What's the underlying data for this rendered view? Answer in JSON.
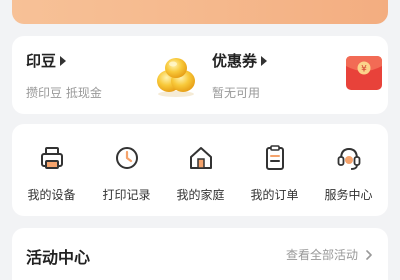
{
  "banner": {
    "items": [
      "",
      "",
      "",
      ""
    ]
  },
  "assets": {
    "yindou": {
      "title": "印豆",
      "subtitle": "攒印豆 抵现金"
    },
    "coupon": {
      "title": "优惠券",
      "subtitle": "暂无可用",
      "envelope_mark": "¥"
    }
  },
  "menu": {
    "items": [
      {
        "label": "我的设备",
        "icon": "printer-icon"
      },
      {
        "label": "打印记录",
        "icon": "clock-icon"
      },
      {
        "label": "我的家庭",
        "icon": "home-icon"
      },
      {
        "label": "我的订单",
        "icon": "order-list-icon"
      },
      {
        "label": "服务中心",
        "icon": "customer-service-icon"
      }
    ]
  },
  "activity": {
    "title": "活动中心",
    "view_all": "查看全部活动"
  },
  "colors": {
    "accent_orange": "#f3ad80",
    "envelope_red": "#e8423a",
    "gold": "#f5b82e"
  }
}
